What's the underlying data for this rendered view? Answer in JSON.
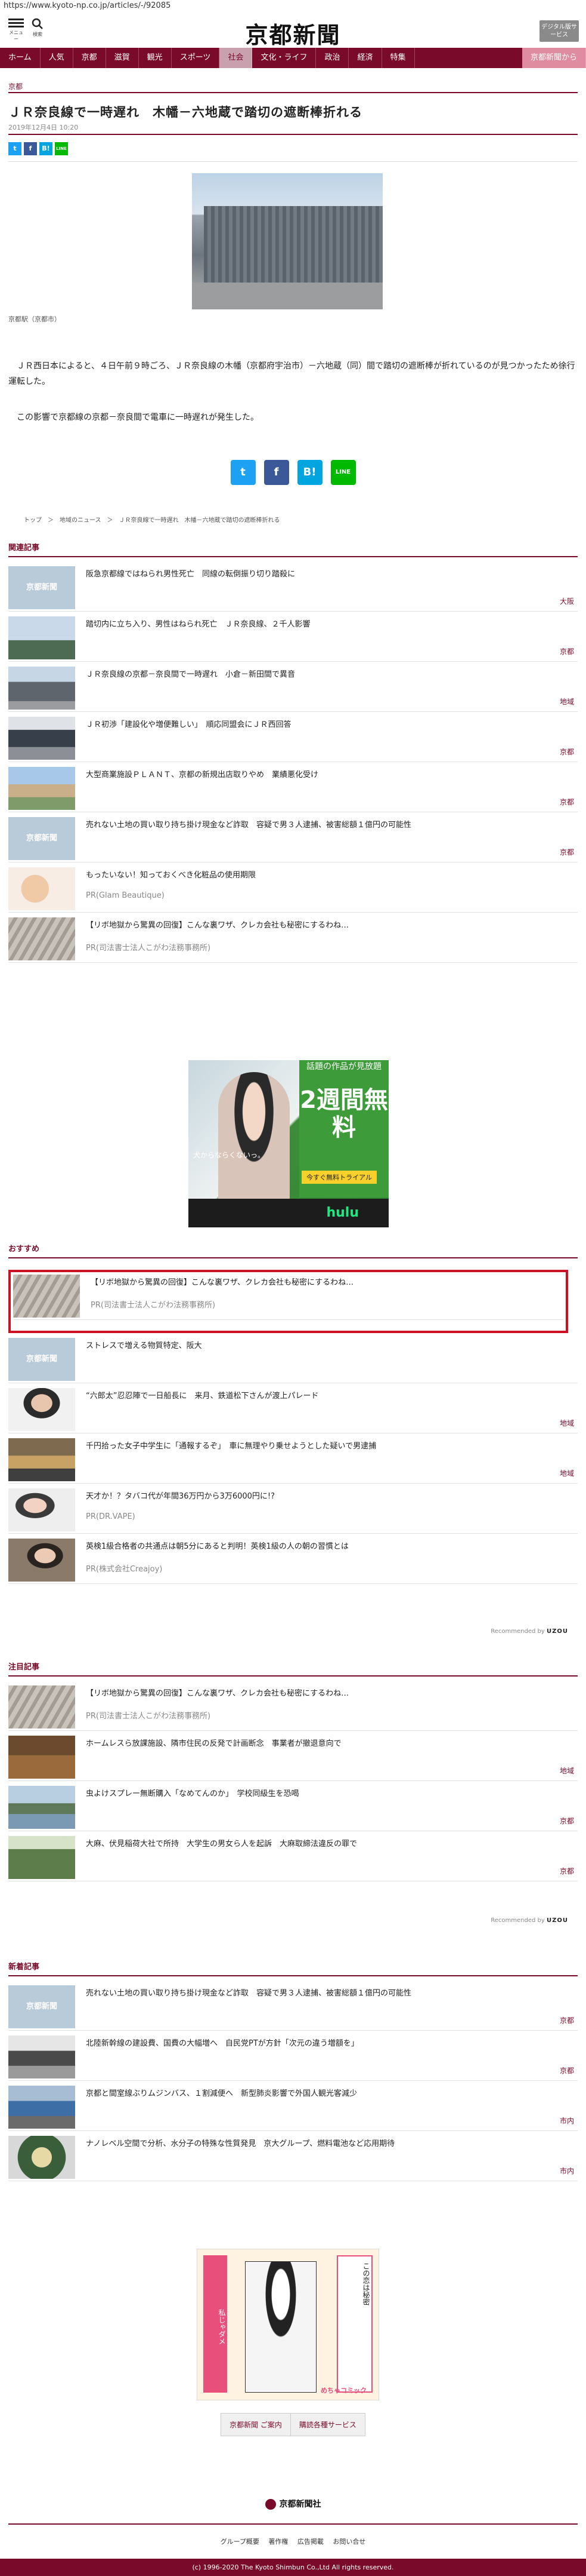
{
  "url": "https://www.kyoto-np.co.jp/articles/-/92085",
  "header": {
    "menu_label": "メニュー",
    "search_label": "検索",
    "logo": "京都新聞",
    "digital_label": "デジタル版サービス"
  },
  "nav": [
    {
      "label": "ホーム"
    },
    {
      "label": "人気"
    },
    {
      "label": "京都"
    },
    {
      "label": "滋賀"
    },
    {
      "label": "観光"
    },
    {
      "label": "スポーツ"
    },
    {
      "label": "社会"
    },
    {
      "label": "文化・ライフ"
    },
    {
      "label": "政治"
    },
    {
      "label": "経済"
    },
    {
      "label": "特集"
    },
    {
      "label": "京都新聞から"
    }
  ],
  "article": {
    "section": "京都",
    "title": "ＪＲ奈良線で一時遅れ　木幡－六地蔵で踏切の遮断棒折れる",
    "date": "2019年12月4日 10:20",
    "photo_caption": "京都駅（京都市）",
    "para1": "　ＪＲ西日本によると、４日午前９時ごろ、ＪＲ奈良線の木幡（京都府宇治市）－六地蔵（同）間で踏切の遮断棒が折れているのが見つかったため徐行運転した。",
    "para2": "　この影響で京都線の京都－奈良間で電車に一時遅れが発生した。"
  },
  "share": {
    "twitter": "t",
    "facebook": "f",
    "hatena": "B!",
    "line": "LINE"
  },
  "breadcrumb": "トップ　＞　地域のニュース　＞　ＪＲ奈良線で一時遅れ　木幡－六地蔵で踏切の遮断棒折れる",
  "related": {
    "heading": "関連記事",
    "items": [
      {
        "title": "阪急京都線ではねられ男性死亡　同線の転倒振り切り踏殺に",
        "tag": "大阪"
      },
      {
        "title": "踏切内に立ち入り、男性はねられ死亡　ＪＲ奈良線、２千人影響",
        "tag": "京都"
      },
      {
        "title": "ＪＲ奈良線の京都－奈良間で一時遅れ　小倉－新田間で異音",
        "tag": "地域"
      },
      {
        "title": "ＪＲ初渉「建設化や増便難しい」　順応同盟会にＪＲ西回答",
        "tag": "京都"
      },
      {
        "title": "大型商業施設ＰＬＡＮＴ、京都の新規出店取りやめ　業績悪化受け",
        "tag": "京都"
      },
      {
        "title": "売れない土地の買い取り持ち掛け現金など詐取　容疑で男３人逮捕、被害総額１億円の可能性",
        "tag": "京都"
      },
      {
        "title": "もったいない！知っておくべき化粧品の使用期限",
        "pr": "PR(Glam Beautique)"
      },
      {
        "title": "【リボ地獄から驚異の回復】こんな裏ワザ、クレカ会社も秘密にするわね…",
        "pr": "PR(司法書士法人こがわ法務事務所)"
      }
    ]
  },
  "ad1": {
    "big_text": "2週間無料",
    "small_text": "話題の作品が見放題",
    "button": "今すぐ無料トライアル",
    "copy": "犬からならくないっ。",
    "brand": "hulu"
  },
  "recommend": {
    "heading": "おすすめ",
    "items": [
      {
        "title": "【リボ地獄から驚異の回復】こんな裏ワザ、クレカ会社も秘密にするわね…",
        "pr": "PR(司法書士法人こがわ法務事務所)"
      },
      {
        "title": "ストレスで増える物質特定、阪大",
        "tag": ""
      },
      {
        "title": "“六郎太”忍忍陣で一日船長に　来月、鉄道松下さんが渡上パレード",
        "tag": "地域"
      },
      {
        "title": "千円拾った女子中学生に「通報するぞ」　車に無理やり乗せようとした疑いで男逮捕",
        "tag": "地域"
      },
      {
        "title": "天才か！？タバコ代が年間36万円から3万6000円に!?",
        "pr": "PR(DR.VAPE)"
      },
      {
        "title": "英検1級合格者の共通点は朝5分にあると判明！英検1級の人の朝の習慣とは",
        "pr": "PR(株式会社Creajoy)"
      }
    ],
    "credit": "Recommended by",
    "credit_brand": "UZOU"
  },
  "attention": {
    "heading": "注目記事",
    "items": [
      {
        "title": "【リボ地獄から驚異の回復】こんな裏ワザ、クレカ会社も秘密にするわね…",
        "pr": "PR(司法書士法人こがわ法務事務所)"
      },
      {
        "title": "ホームレスら放課施設、隣市住民の反発で計画断念　事業者が撤退意向で",
        "tag": "地域"
      },
      {
        "title": "虫よけスプレー無断購入「なめてんのか」　学校同級生を恐喝",
        "tag": "京都"
      },
      {
        "title": "大麻、伏見稲荷大社で所持　大学生の男女ら人を起訴　大麻取締法違反の罪で",
        "tag": "京都"
      }
    ],
    "credit": "Recommended by",
    "credit_brand": "UZOU"
  },
  "latest": {
    "heading": "新着記事",
    "items": [
      {
        "title": "売れない土地の買い取り持ち掛け現金など詐取　容疑で男３人逮捕、被害総額１億円の可能性",
        "tag": "京都"
      },
      {
        "title": "北陸新幹線の建設費、国費の大幅増へ　自民党PTが方針「次元の違う増額を」",
        "tag": "京都"
      },
      {
        "title": "京都と間室線ぶりムジンバス、１割減便へ　新型肺炎影響で外国人観光客減少",
        "tag": "市内"
      },
      {
        "title": "ナノレベル空間で分析、水分子の特殊な性質発見　京大グループ、燃料電池など応用期待",
        "tag": "市内"
      }
    ]
  },
  "ad2": {
    "left_text": "私じゃダメ",
    "right_text": "この恋は秘密",
    "brand": "めちゃコミック"
  },
  "footer": {
    "button1": "京都新聞 ご案内",
    "button2": "購読各種サービス",
    "logo": "京都新聞社",
    "links": [
      "グループ概要",
      "著作権",
      "広告掲載",
      "お問い合せ"
    ],
    "copyright": "(c) 1996-2020 The Kyoto Shimbun Co.,Ltd All rights reserved."
  }
}
